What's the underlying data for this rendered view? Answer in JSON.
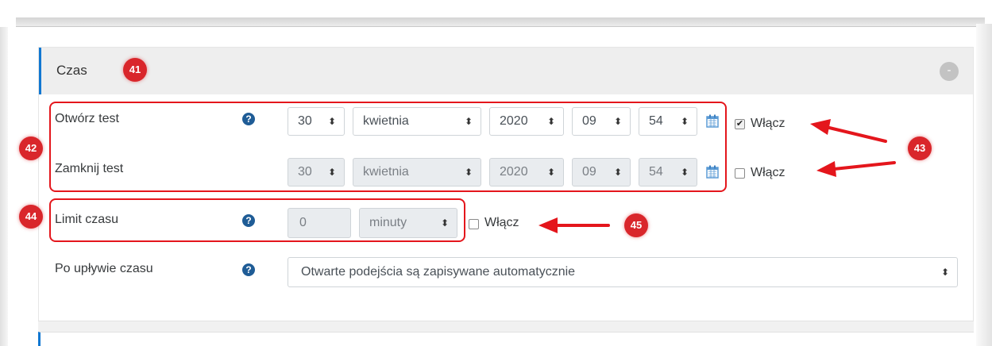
{
  "section": {
    "title": "Czas",
    "collapse_label": "-"
  },
  "rows": {
    "open": {
      "label": "Otwórz test",
      "day": "30",
      "month": "kwietnia",
      "year": "2020",
      "hour": "09",
      "minute": "54",
      "enabled_label": "Włącz",
      "enabled": true
    },
    "close": {
      "label": "Zamknij test",
      "day": "30",
      "month": "kwietnia",
      "year": "2020",
      "hour": "09",
      "minute": "54",
      "enabled_label": "Włącz",
      "enabled": false
    },
    "limit": {
      "label": "Limit czasu",
      "value": "0",
      "unit": "minuty",
      "enabled_label": "Włącz",
      "enabled": false
    },
    "overdue": {
      "label": "Po upływie czasu",
      "value": "Otwarte podejścia są zapisywane automatycznie"
    }
  },
  "icons": {
    "help": "?",
    "select_arrow": "⬍",
    "checkmark": "✔"
  },
  "annotations": {
    "badge_41": "41",
    "badge_42": "42",
    "badge_43": "43",
    "badge_44": "44",
    "badge_45": "45"
  },
  "colors": {
    "accent": "#1177d1",
    "annotation_red": "#e4161c",
    "help_icon": "#1f5c96"
  }
}
